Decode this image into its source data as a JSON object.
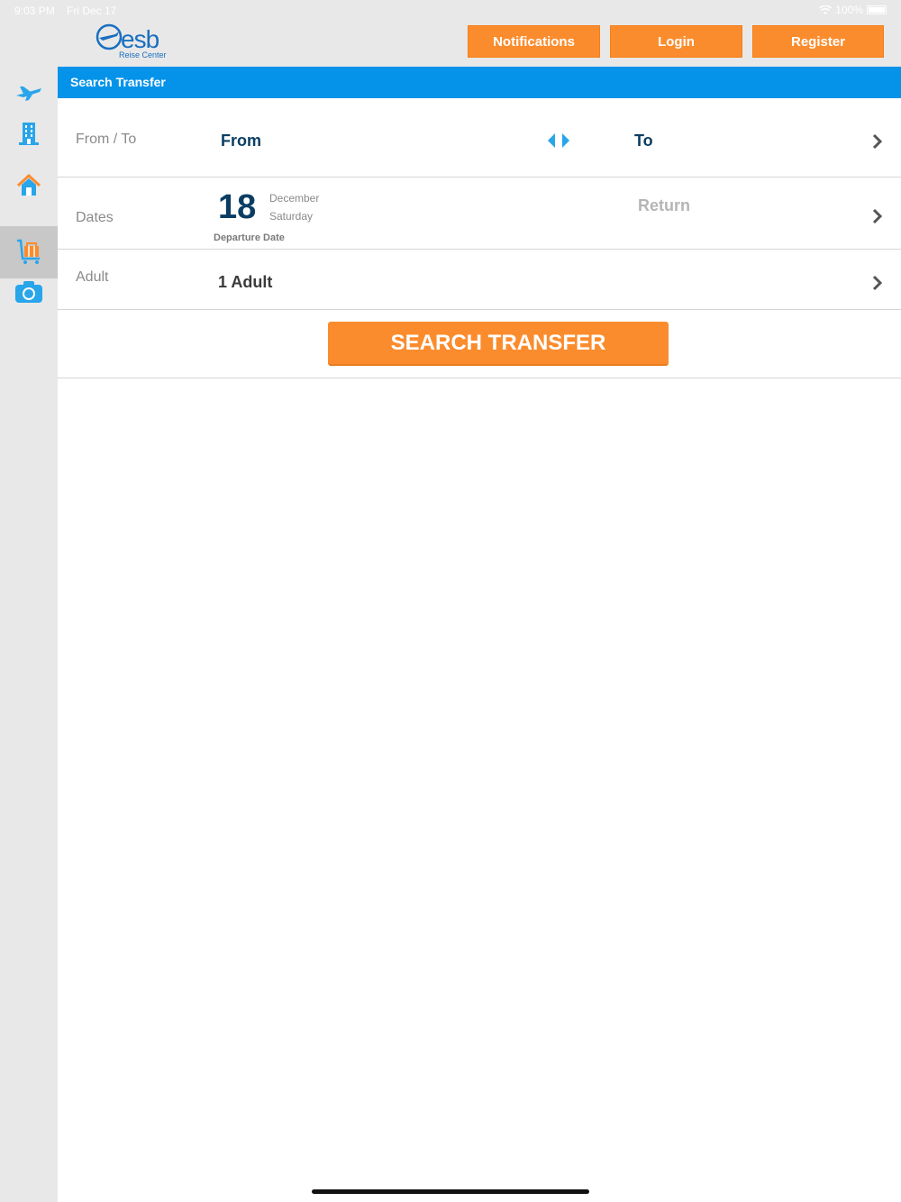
{
  "status": {
    "time": "9:03 PM",
    "date": "Fri Dec 17",
    "battery": "100%"
  },
  "header": {
    "logo_text": "esb",
    "logo_sub": "Reise Center",
    "notifications_label": "Notifications",
    "login_label": "Login",
    "register_label": "Register"
  },
  "sidebar": {
    "items": [
      {
        "icon": "plane-icon"
      },
      {
        "icon": "building-icon"
      },
      {
        "icon": "house-icon"
      },
      {
        "icon": "luggage-cart-icon",
        "active": true
      },
      {
        "icon": "camera-icon"
      }
    ]
  },
  "main": {
    "title": "Search Transfer",
    "fromto": {
      "label": "From / To",
      "from": "From",
      "to": "To"
    },
    "dates": {
      "label": "Dates",
      "day": "18",
      "month": "December",
      "weekday": "Saturday",
      "departure_label": "Departure Date",
      "return_label": "Return"
    },
    "adult": {
      "label": "Adult",
      "value": "1 Adult"
    },
    "search_label": "SEARCH TRANSFER"
  },
  "colors": {
    "accent_orange": "#fb8c2d",
    "accent_blue": "#0593ea",
    "dark_navy": "#0b3d63"
  }
}
